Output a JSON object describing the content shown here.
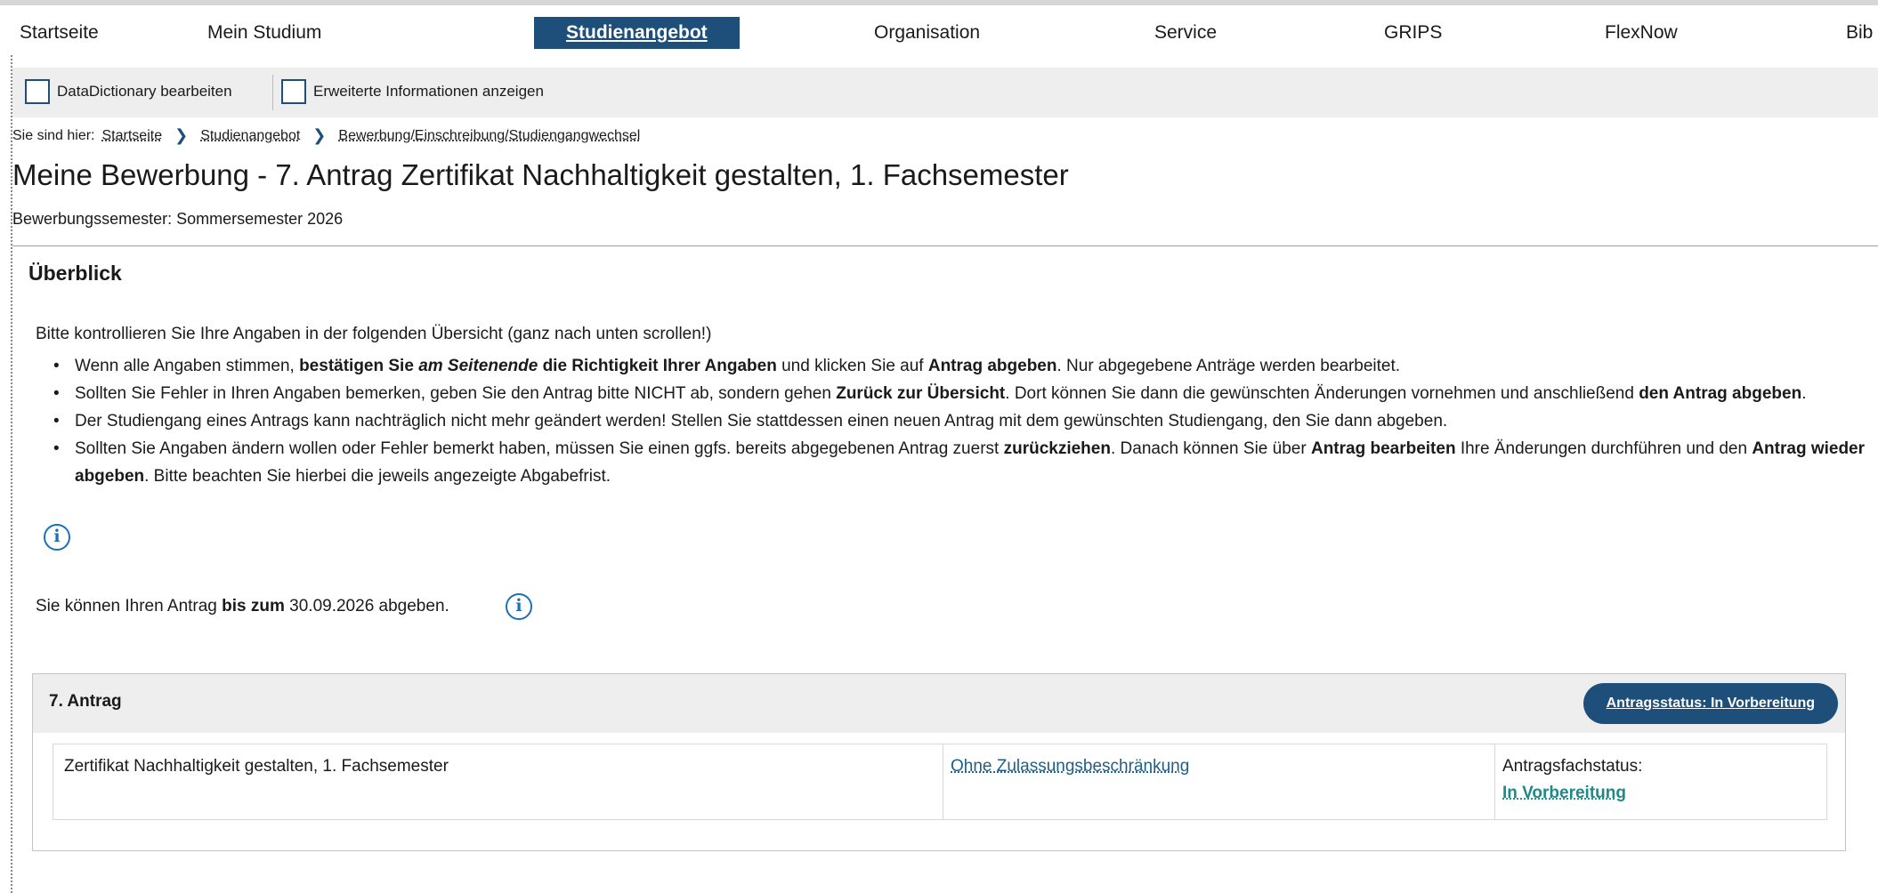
{
  "topnav": {
    "items": [
      {
        "label": "Startseite"
      },
      {
        "label": "Mein Studium"
      },
      {
        "label": "Studienangebot",
        "active": true
      },
      {
        "label": "Organisation"
      },
      {
        "label": "Service"
      },
      {
        "label": "GRIPS"
      },
      {
        "label": "FlexNow"
      },
      {
        "label": "Bib"
      }
    ]
  },
  "toolbar": {
    "datadictionary_label": "DataDictionary bearbeiten",
    "extended_info_label": "Erweiterte Informationen anzeigen"
  },
  "breadcrumb": {
    "prefix": "Sie sind hier:",
    "items": [
      "Startseite",
      "Studienangebot",
      "Bewerbung/Einschreibung/Studiengangwechsel"
    ]
  },
  "page": {
    "title": "Meine Bewerbung - 7. Antrag Zertifikat Nachhaltigkeit gestalten, 1. Fachsemester",
    "semester": "Bewerbungssemester: Sommersemester 2026"
  },
  "overview": {
    "title": "Überblick",
    "intro": "Bitte kontrollieren Sie Ihre Angaben in der folgenden Übersicht (ganz nach unten scrollen!)",
    "bullet1": {
      "t1": "Wenn alle Angaben stimmen, ",
      "b1": "bestätigen Sie ",
      "bi1": "am Seitenende",
      "b2": " die Richtigkeit Ihrer Angaben",
      "t2": " und klicken Sie auf ",
      "b3": "Antrag abgeben",
      "t3": ". Nur abgegebene Anträge werden bearbeitet."
    },
    "bullet2": {
      "t1": "Sollten Sie Fehler in Ihren Angaben bemerken, geben Sie den Antrag bitte NICHT ab, sondern gehen ",
      "b1": "Zurück zur Übersicht",
      "t2": ". Dort können Sie dann die gewünschten Änderungen vornehmen und anschließend ",
      "b2": "den Antrag abgeben",
      "t3": "."
    },
    "bullet3": {
      "t1": "Der Studiengang eines Antrags kann nachträglich nicht mehr geändert werden! Stellen Sie stattdessen einen neuen Antrag mit dem gewünschten Studiengang, den Sie dann abgeben."
    },
    "bullet4": {
      "t1": "Sollten Sie Angaben ändern wollen oder Fehler bemerkt haben, müssen Sie einen ggfs. bereits abgegebenen Antrag zuerst ",
      "b1": "zurückziehen",
      "t2": ". Danach können Sie über ",
      "b2": "Antrag bearbeiten",
      "t3": " Ihre Änderungen durchführen und den ",
      "b3": "Antrag wieder abgeben",
      "t4": ". Bitte beachten Sie hierbei die jeweils angezeigte Abgabefrist."
    },
    "deadline": {
      "t1": "Sie können Ihren Antrag ",
      "b1": "bis zum",
      "t2": " 30.09.2026 abgeben."
    }
  },
  "application": {
    "title": "7. Antrag",
    "status_button": "Antragsstatus: In Vorbereitung",
    "program": "Zertifikat Nachhaltigkeit gestalten, 1. Fachsemester",
    "admission": "Ohne Zulassungsbeschränkung",
    "subject_status_label": "Antragsfachstatus:",
    "subject_status_value": "In Vorbereitung"
  },
  "icons": {
    "info": "info-icon",
    "checkbox": "checkbox-icon",
    "breadcrumb_separator": "chevron-right-icon"
  },
  "colors": {
    "accent": "#1d4f7a",
    "link": "#1d5f8a",
    "status_link": "#1b8a8a",
    "info": "#1d6fb8",
    "toolbar_bg": "#eeeeee"
  }
}
